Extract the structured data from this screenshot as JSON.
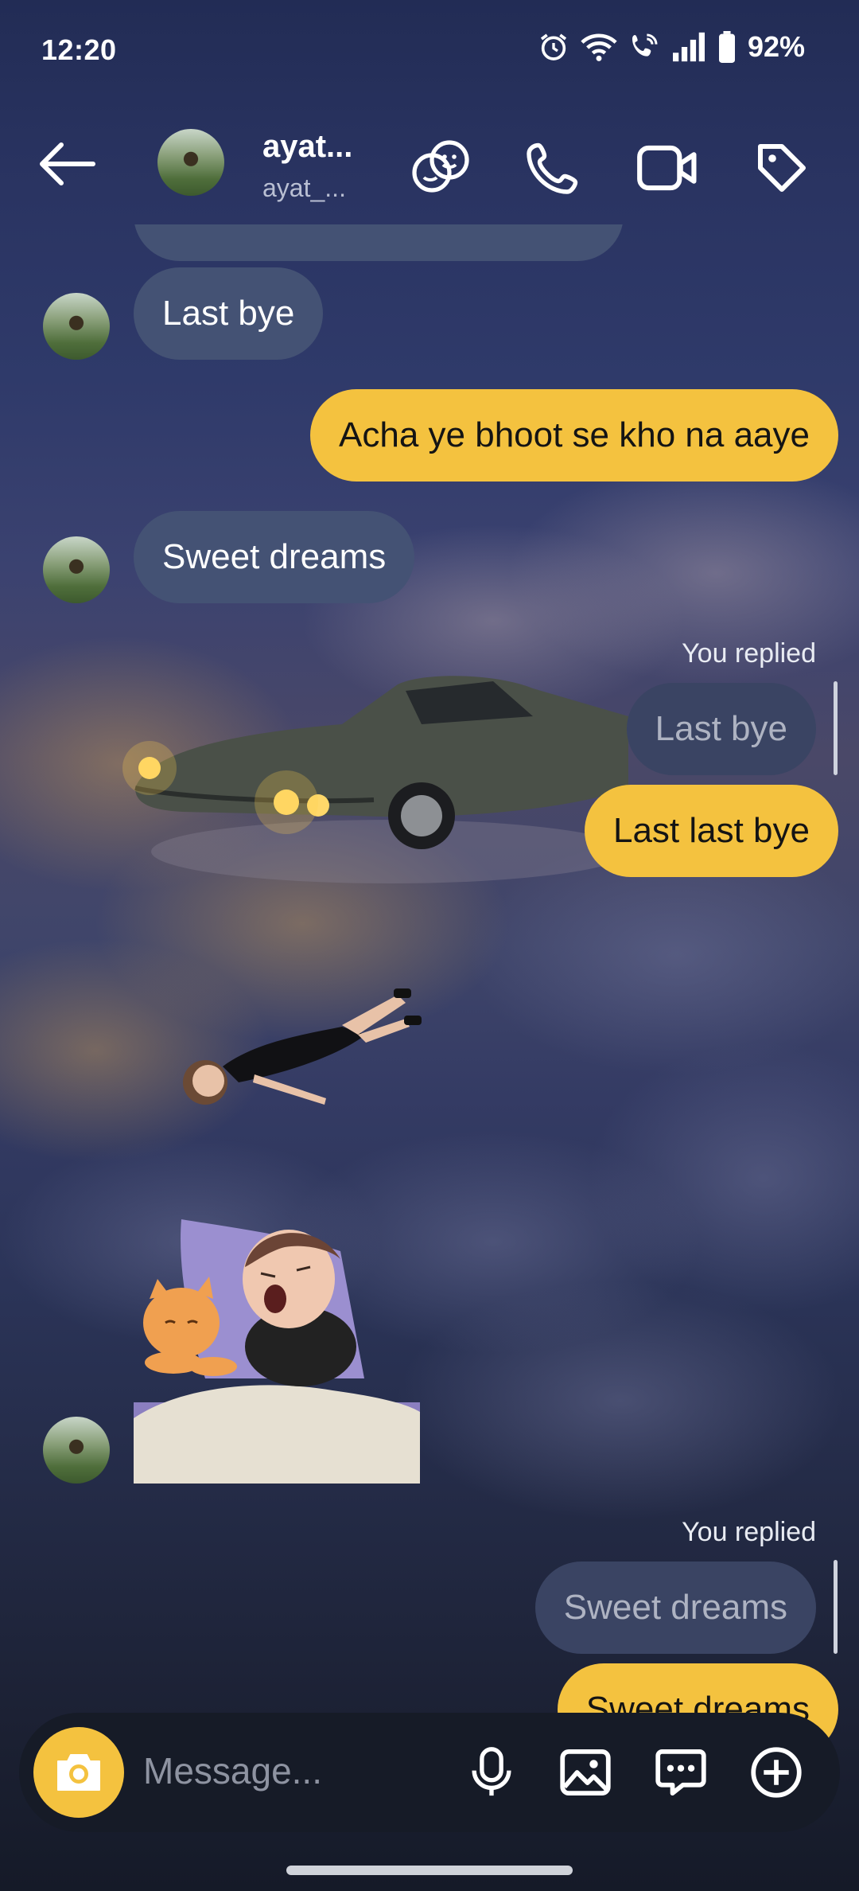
{
  "status_bar": {
    "time": "12:20",
    "battery": "92%"
  },
  "header": {
    "contact_name": "ayat...",
    "contact_username": "ayat_..."
  },
  "messages": [
    {
      "direction": "incoming",
      "text": "Last bye"
    },
    {
      "direction": "outgoing",
      "text": "Acha ye bhoot se kho na aaye"
    },
    {
      "direction": "incoming",
      "text": "Sweet dreams"
    },
    {
      "direction": "outgoing",
      "replied_label": "You replied",
      "quoted_text": "Last bye",
      "text": "Last last bye"
    },
    {
      "direction": "incoming",
      "type": "sticker",
      "description": "sleeping-girl-with-cat"
    },
    {
      "direction": "outgoing",
      "replied_label": "You replied",
      "quoted_text": "Sweet dreams",
      "text": "Sweet dreams"
    }
  ],
  "composer": {
    "placeholder": "Message..."
  },
  "colors": {
    "outgoing_bubble": "#f4c23f",
    "incoming_bubble": "#445274",
    "composer_bg": "#161b27"
  }
}
